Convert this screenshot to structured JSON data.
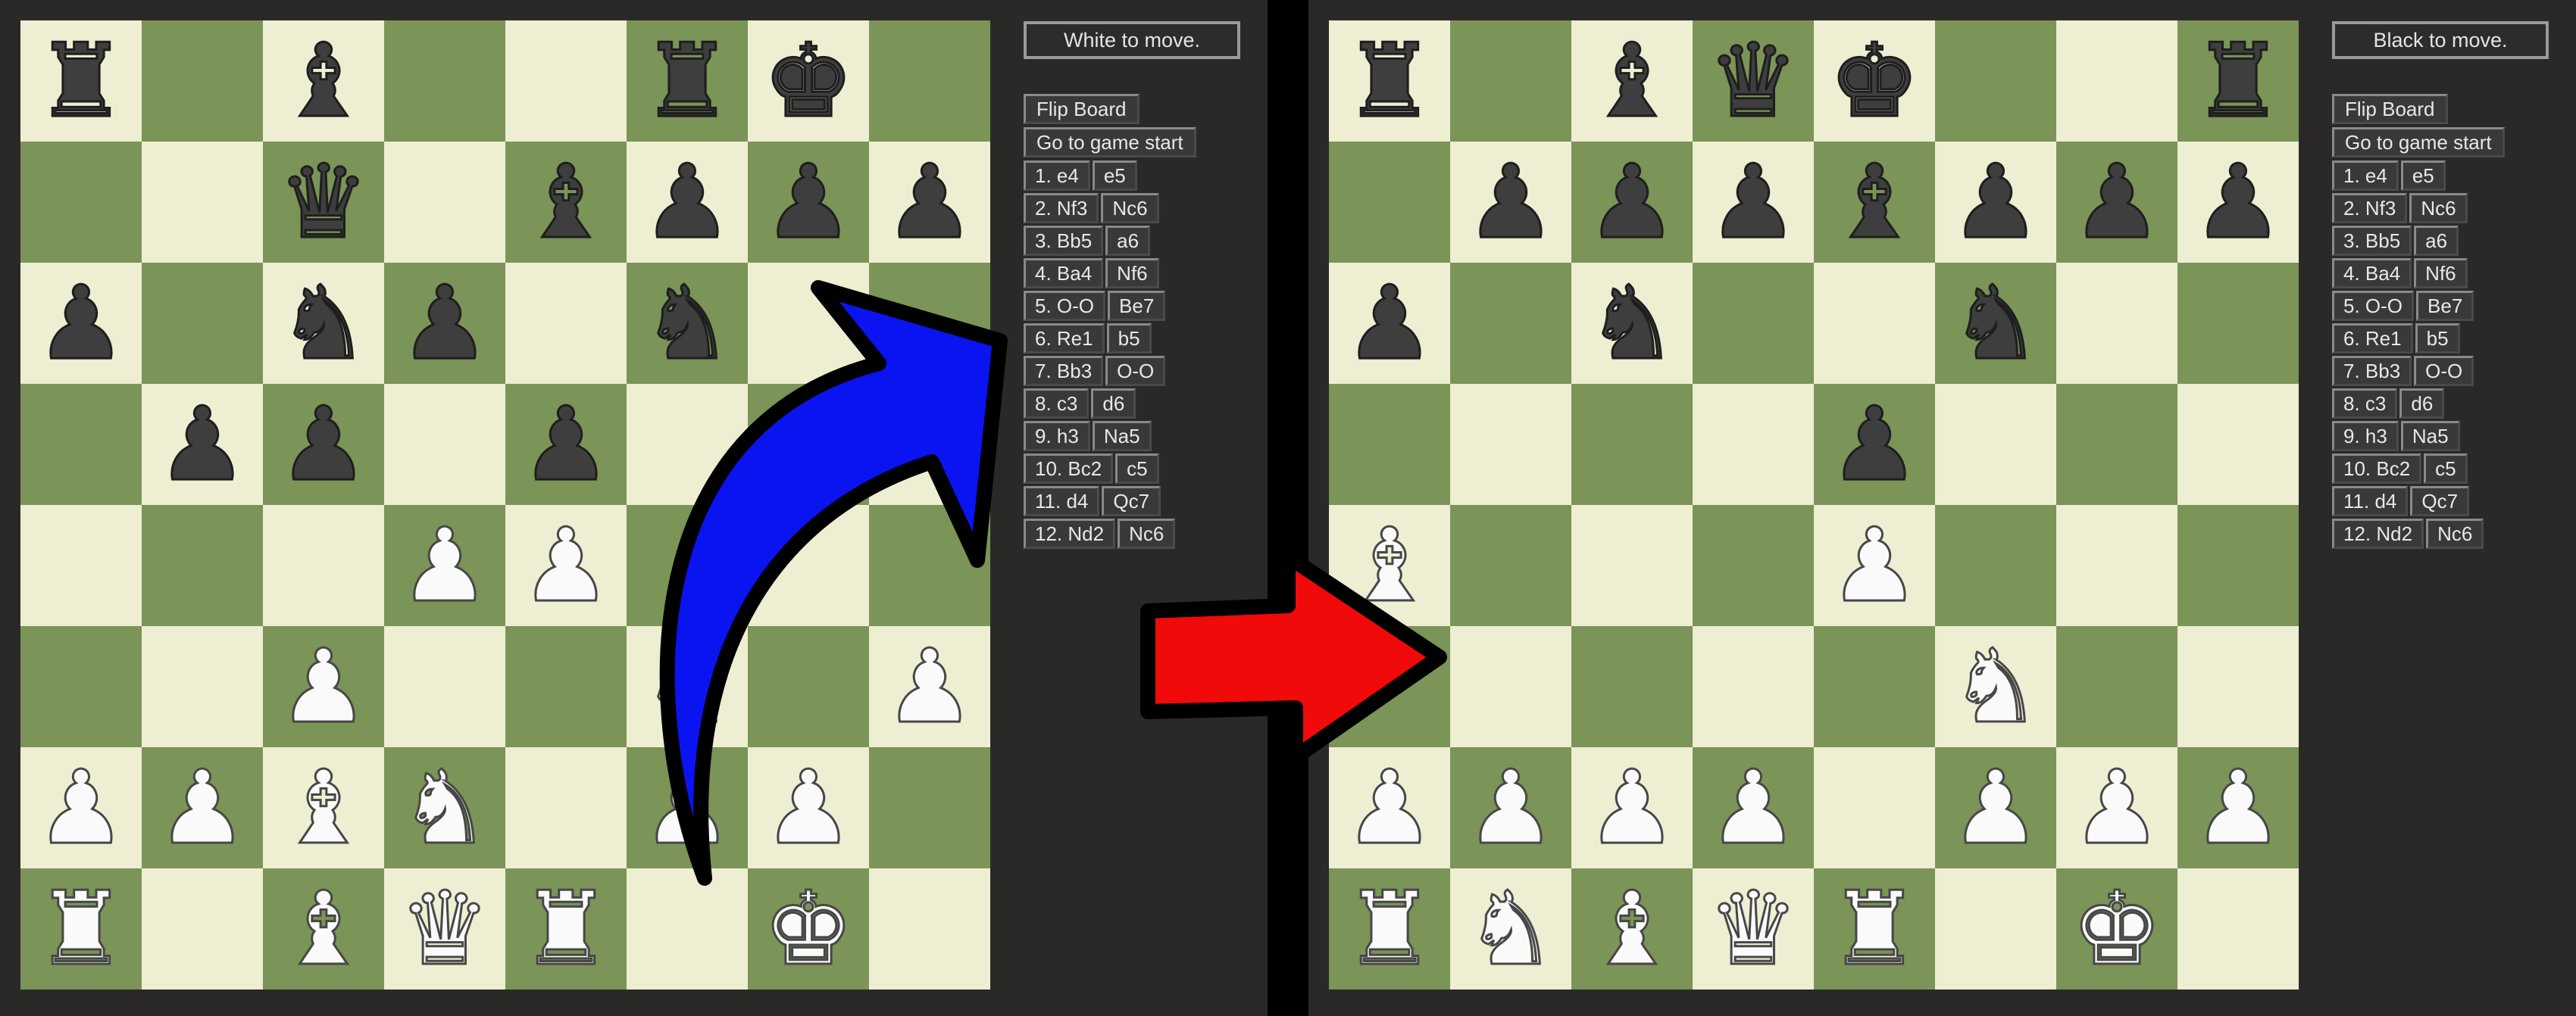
{
  "boards": [
    {
      "id": "left",
      "turn_text": "White to move.",
      "position": [
        [
          "bR",
          "",
          "bB",
          "",
          "",
          "bR",
          "bK",
          ""
        ],
        [
          "",
          "",
          "bQ",
          "",
          "bB",
          "bP",
          "bP",
          "bP"
        ],
        [
          "bP",
          "",
          "bN",
          "bP",
          "",
          "bN",
          "",
          ""
        ],
        [
          "",
          "bP",
          "bP",
          "",
          "bP",
          "",
          "",
          ""
        ],
        [
          "",
          "",
          "",
          "wP",
          "wP",
          "",
          "",
          ""
        ],
        [
          "",
          "",
          "wP",
          "",
          "",
          "wN",
          "",
          "wP"
        ],
        [
          "wP",
          "wP",
          "wB",
          "wN",
          "",
          "wP",
          "wP",
          ""
        ],
        [
          "wR",
          "",
          "wB",
          "wQ",
          "wR",
          "",
          "wK",
          ""
        ]
      ]
    },
    {
      "id": "right",
      "turn_text": "Black to move.",
      "position": [
        [
          "bR",
          "",
          "bB",
          "bQ",
          "bK",
          "",
          "",
          "bR"
        ],
        [
          "",
          "bP",
          "bP",
          "bP",
          "bB",
          "bP",
          "bP",
          "bP"
        ],
        [
          "bP",
          "",
          "bN",
          "",
          "",
          "bN",
          "",
          ""
        ],
        [
          "",
          "",
          "",
          "",
          "bP",
          "",
          "",
          ""
        ],
        [
          "wB",
          "",
          "",
          "",
          "wP",
          "",
          "",
          ""
        ],
        [
          "",
          "",
          "",
          "",
          "",
          "wN",
          "",
          ""
        ],
        [
          "wP",
          "wP",
          "wP",
          "wP",
          "",
          "wP",
          "wP",
          "wP"
        ],
        [
          "wR",
          "wN",
          "wB",
          "wQ",
          "wR",
          "",
          "wK",
          ""
        ]
      ]
    }
  ],
  "controls": {
    "flip_label": "Flip Board",
    "start_label": "Go to game start"
  },
  "moves": [
    {
      "white": "1. e4",
      "black": "e5"
    },
    {
      "white": "2. Nf3",
      "black": "Nc6"
    },
    {
      "white": "3. Bb5",
      "black": "a6"
    },
    {
      "white": "4. Ba4",
      "black": "Nf6"
    },
    {
      "white": "5. O-O",
      "black": "Be7"
    },
    {
      "white": "6. Re1",
      "black": "b5"
    },
    {
      "white": "7. Bb3",
      "black": "O-O"
    },
    {
      "white": "8. c3",
      "black": "d6"
    },
    {
      "white": "9. h3",
      "black": "Na5"
    },
    {
      "white": "10. Bc2",
      "black": "c5"
    },
    {
      "white": "11. d4",
      "black": "Qc7"
    },
    {
      "white": "12. Nd2",
      "black": "Nc6"
    }
  ],
  "colors": {
    "light_square": "#eeeed2",
    "dark_square": "#7b9457",
    "blue_arrow": "#0a14f0",
    "red_arrow": "#f00a0a"
  },
  "piece_glyphs": {
    "K": "♚",
    "Q": "♛",
    "R": "♜",
    "B": "♝",
    "N": "♞",
    "P": "♟"
  }
}
